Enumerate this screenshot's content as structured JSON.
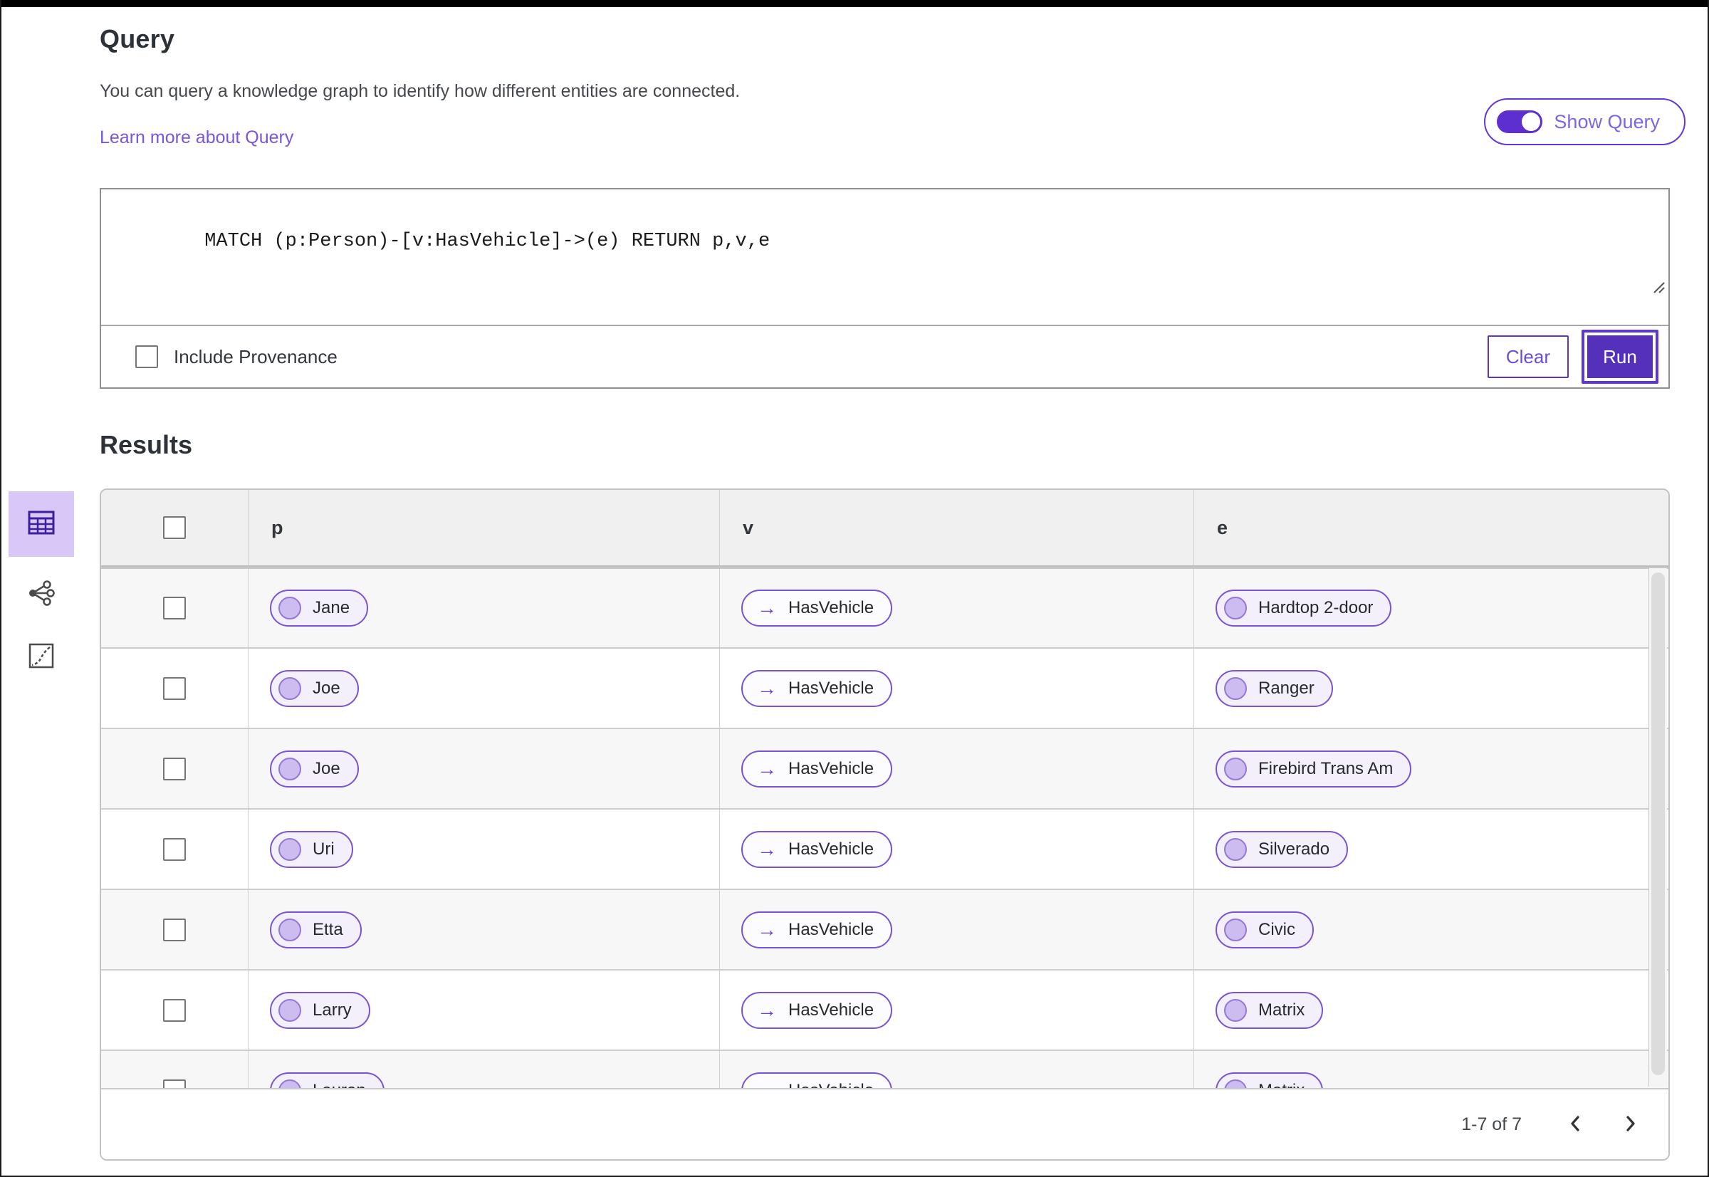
{
  "header": {
    "title": "Query",
    "description": "You can query a knowledge graph to identify how different entities are connected.",
    "learn_more_label": "Learn more about Query",
    "show_query_label": "Show Query",
    "show_query_on": true
  },
  "query_editor": {
    "query_text": "MATCH (p:Person)-[v:HasVehicle]->(e) RETURN p,v,e",
    "include_provenance_label": "Include Provenance",
    "include_provenance_checked": false,
    "clear_label": "Clear",
    "run_label": "Run"
  },
  "results": {
    "heading": "Results",
    "view_modes": [
      {
        "name": "table-view",
        "icon": "table-icon",
        "selected": true
      },
      {
        "name": "graph-view",
        "icon": "graph-nodes-icon",
        "selected": false
      },
      {
        "name": "chart-view",
        "icon": "scatter-chart-icon",
        "selected": false
      }
    ],
    "columns": [
      "p",
      "v",
      "e"
    ],
    "edge_arrow_glyph": "→",
    "rows": [
      {
        "p": "Jane",
        "v": "HasVehicle",
        "e": "Hardtop 2-door"
      },
      {
        "p": "Joe",
        "v": "HasVehicle",
        "e": "Ranger"
      },
      {
        "p": "Joe",
        "v": "HasVehicle",
        "e": "Firebird Trans Am"
      },
      {
        "p": "Uri",
        "v": "HasVehicle",
        "e": "Silverado"
      },
      {
        "p": "Etta",
        "v": "HasVehicle",
        "e": "Civic"
      },
      {
        "p": "Larry",
        "v": "HasVehicle",
        "e": "Matrix"
      },
      {
        "p": "Lauren",
        "v": "HasVehicle",
        "e": "Matrix"
      }
    ],
    "pagination": {
      "range_label": "1-7 of 7"
    }
  },
  "colors": {
    "accent": "#5531bb",
    "accent_border": "#5d36d9",
    "pill_border": "#7a52d4",
    "pill_bg": "#f3f0fc",
    "node_dot_fill": "#cdbcf0",
    "link": "#7a55dd",
    "selected_view_bg": "#d9c8f7",
    "header_row_bg": "#f0f0f0",
    "alt_row_bg": "#f7f7f7"
  }
}
